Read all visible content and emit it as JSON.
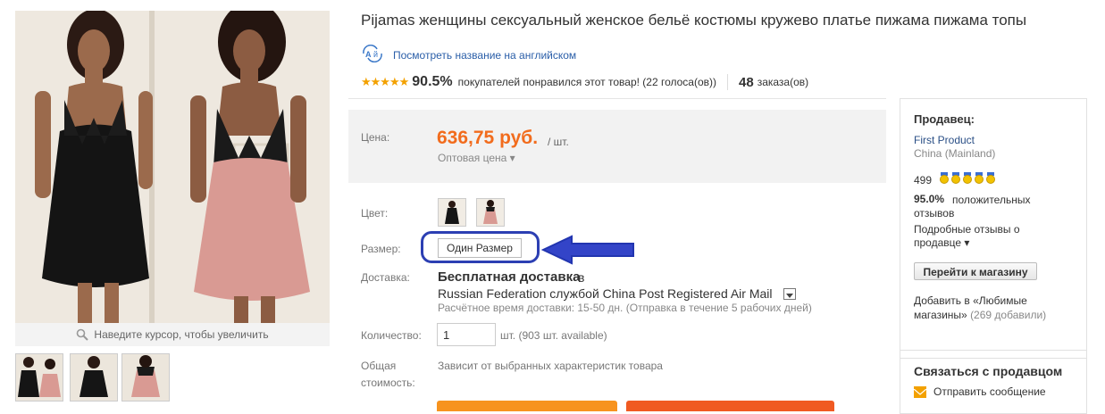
{
  "gallery": {
    "zoom_hint": "Наведите курсор, чтобы увеличить"
  },
  "product": {
    "title": "Pijamas женщины сексуальный женское бельё костюмы кружево платье пижама пижама топы",
    "translate_link": "Посмотреть название на английском",
    "rating_stars": "★★★★★",
    "rating_percent": "90.5%",
    "rating_text": "покупателей понравился этот товар! (22 голоса(ов))",
    "orders_count": "48",
    "orders_label": "заказа(ов)"
  },
  "price": {
    "label": "Цена:",
    "value": "636,75 руб.",
    "unit": "/ шт.",
    "wholesale": "Оптовая цена ▾"
  },
  "options": {
    "color_label": "Цвет:",
    "colors": [
      "black",
      "pink"
    ],
    "size_label": "Размер:",
    "size_value": "Один Размер"
  },
  "shipping": {
    "label": "Доставка:",
    "free": "Бесплатная доставка",
    "in": "в",
    "country": "Russian Federation службой China Post Registered Air Mail",
    "time": "Расчётное время доставки: 15-50 дн. (Отправка в течение 5 рабочих дней)"
  },
  "quantity": {
    "label": "Количество:",
    "value": "1",
    "available": "шт. (903 шт. available)"
  },
  "total": {
    "label_line1": "Общая",
    "label_line2": "стоимость:",
    "text": "Зависит от выбранных характеристик товара"
  },
  "seller": {
    "heading": "Продавец:",
    "name": "First Product",
    "location": "China (Mainland)",
    "score": "499",
    "positive_pct": "95.0%",
    "positive_text_1": "положительных",
    "positive_text_2": "отзывов",
    "detail_reviews_1": "Подробные отзывы о",
    "detail_reviews_2": "продавце ▾",
    "store_button": "Перейти к магазину",
    "fav_line1": "Добавить в «Любимые",
    "fav_line2": "магазины»",
    "fav_count": "(269 добавили)"
  },
  "contact": {
    "heading": "Связаться с продавцом",
    "send_message": "Отправить сообщение"
  },
  "colors": {
    "price_orange": "#f26c1d",
    "link_blue": "#2a5ea8",
    "highlight_blue": "#2c3fb3",
    "buy_button": "#f7931e",
    "cart_button": "#f05a22"
  }
}
